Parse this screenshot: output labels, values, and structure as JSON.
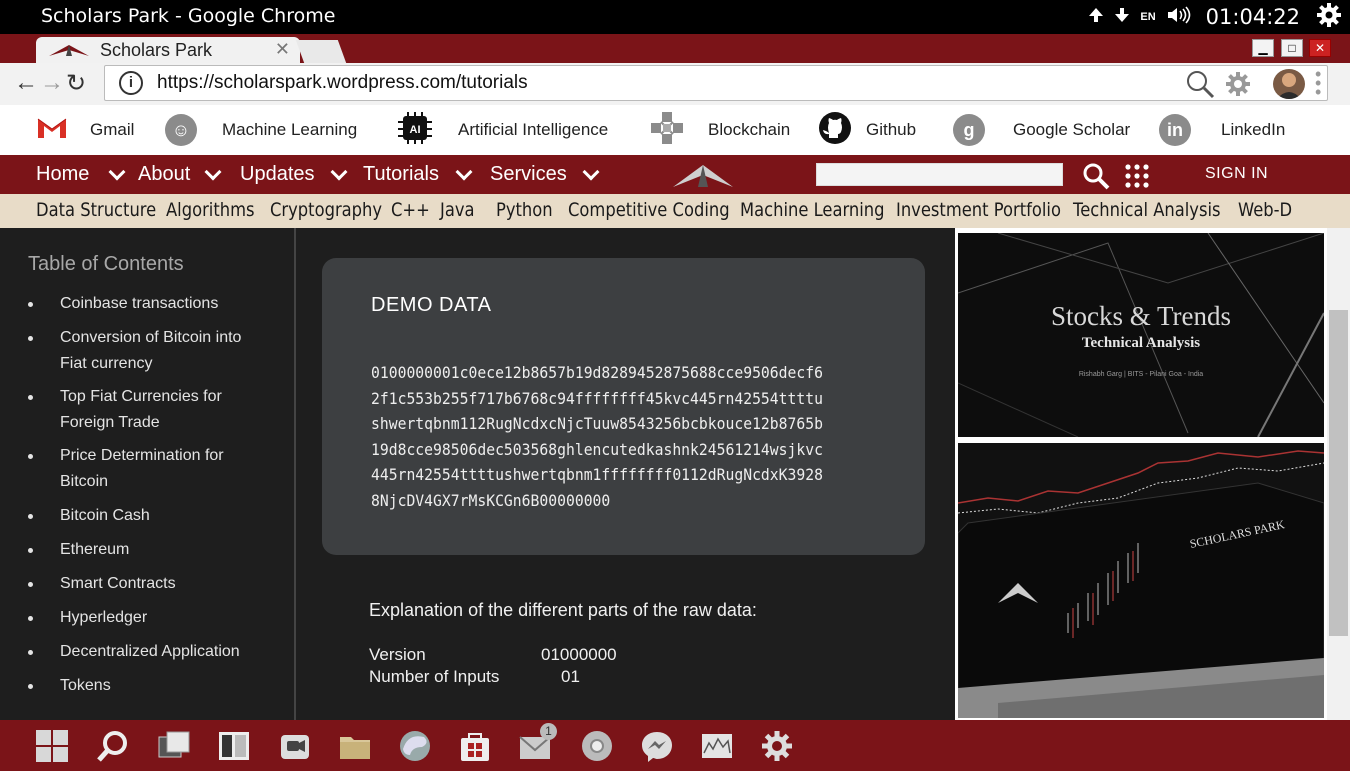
{
  "os": {
    "window_title": "Scholars Park - Google Chrome",
    "language": "EN",
    "clock": "01:04:22"
  },
  "browser": {
    "tab_title": "Scholars Park",
    "url": "https://scholarspark.wordpress.com/tutorials"
  },
  "bookmarks": [
    {
      "label": "Gmail",
      "icon": "gmail-icon"
    },
    {
      "label": "Machine Learning",
      "icon": "brain-icon"
    },
    {
      "label": "Artificial Intelligence",
      "icon": "ai-chip-icon"
    },
    {
      "label": "Blockchain",
      "icon": "blockchain-icon"
    },
    {
      "label": "Github",
      "icon": "github-icon"
    },
    {
      "label": "Google Scholar",
      "icon": "google-icon"
    },
    {
      "label": "LinkedIn",
      "icon": "linkedin-icon"
    }
  ],
  "site_nav": {
    "items": [
      "Home",
      "About",
      "Updates",
      "Tutorials",
      "Services"
    ],
    "sign_in": "SIGN IN"
  },
  "categories": [
    "Data Structure",
    "Algorithms",
    "Cryptography",
    "C++",
    "Java",
    "Python",
    "Competitive Coding",
    "Machine Learning",
    "Investment Portfolio",
    "Technical Analysis",
    "Web-D"
  ],
  "toc": {
    "title": "Table of Contents",
    "items": [
      "Coinbase transactions",
      "Conversion of Bitcoin into Fiat currency",
      "Top Fiat Currencies for Foreign Trade",
      "Price Determination for Bitcoin",
      "Bitcoin Cash",
      "Ethereum",
      "Smart Contracts",
      "Hyperledger",
      "Decentralized Application",
      "Tokens"
    ]
  },
  "demo": {
    "heading": "DEMO DATA",
    "raw": "0100000001c0ece12b8657b19d8289452875688cce9506decf62f1c553b255f717b6768c94ffffffff45kvc445rn42554ttttushwertqbnm112RugNcdxcNjcTuuw8543256bcbkouce12b8765b19d8cce98506dec503568ghlencutedkashnk24561214wsjkvc445rn42554ttttushwertqbnm1ffffffff0112dRugNcdxK39288NjcDV4GX7rMsKCGn6B00000000"
  },
  "explanation": {
    "heading": "Explanation of the different parts of the raw data:",
    "rows": [
      {
        "label": "Version",
        "value": "01000000"
      },
      {
        "label": "Number of Inputs",
        "value": "01"
      }
    ]
  },
  "ads": {
    "ad1_title": "Stocks & Trends",
    "ad1_subtitle": "Technical Analysis",
    "ad1_credit": "Rishabh Garg | BITS - Pilani Goa - India",
    "ad2_brand": "SCHOLARS PARK"
  },
  "taskbar": {
    "mail_badge": "1"
  }
}
